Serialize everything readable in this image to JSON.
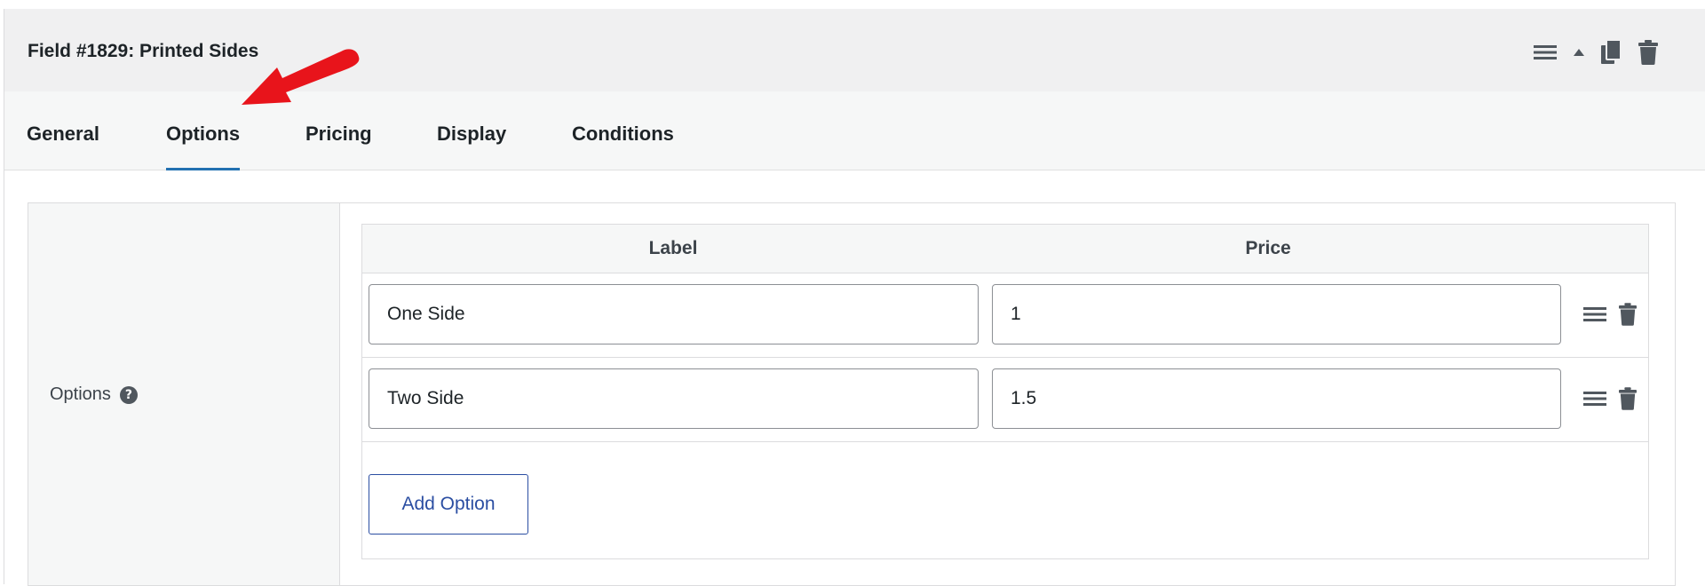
{
  "field": {
    "title": "Field #1829: Printed Sides",
    "actions": [
      {
        "name": "reorder",
        "icon": "menu-icon"
      },
      {
        "name": "collapse",
        "icon": "triangle-up-icon"
      },
      {
        "name": "duplicate",
        "icon": "copy-icon"
      },
      {
        "name": "delete",
        "icon": "trash-icon"
      }
    ]
  },
  "tabs": [
    {
      "label": "General",
      "active": false
    },
    {
      "label": "Options",
      "active": true
    },
    {
      "label": "Pricing",
      "active": false
    },
    {
      "label": "Display",
      "active": false
    },
    {
      "label": "Conditions",
      "active": false
    }
  ],
  "options_section": {
    "label": "Options",
    "help_icon": "question-circle-icon",
    "columns": [
      "Label",
      "Price"
    ],
    "rows": [
      {
        "label": "One Side",
        "price": "1"
      },
      {
        "label": "Two Side",
        "price": "1.5"
      }
    ],
    "add_button": "Add Option"
  },
  "colors": {
    "accent": "#2271b1",
    "button_text": "#2b4ea2",
    "annotation_arrow": "#e8141b",
    "header_bg": "#f0f0f1"
  }
}
